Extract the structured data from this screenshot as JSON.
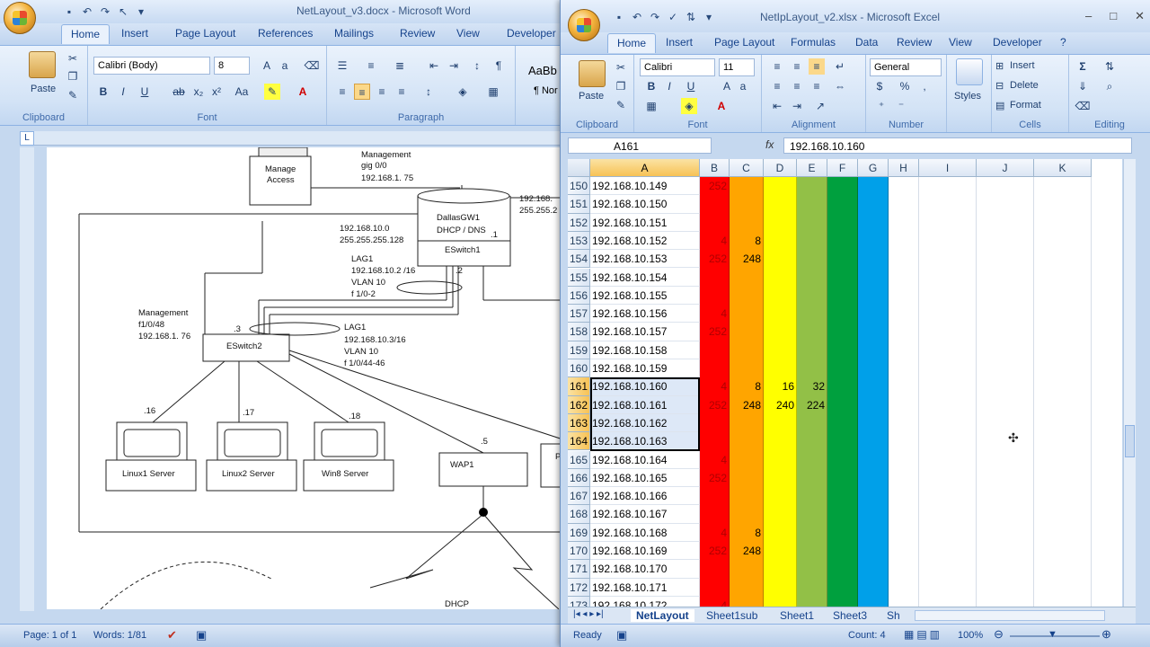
{
  "word": {
    "title": "NetLayout_v3.docx - Microsoft Word",
    "tabs": [
      "Home",
      "Insert",
      "Page Layout",
      "References",
      "Mailings",
      "Review",
      "View",
      "Developer"
    ],
    "font_name": "Calibri (Body)",
    "font_size": "8",
    "styles_preview": "AaBb",
    "styles_sub": "¶ Nor",
    "groups": {
      "clipboard": "Clipboard",
      "font": "Font",
      "paragraph": "Paragraph"
    },
    "paste_label": "Paste",
    "status": {
      "page": "Page: 1 of 1",
      "words": "Words: 1/81"
    },
    "diagram": {
      "manage_access": [
        "Manage",
        "Access"
      ],
      "mgmt_top": [
        "Management",
        "gig 0/0",
        "192.168.1. 75"
      ],
      "gw": [
        "DallasGW1",
        "DHCP / DNS"
      ],
      "eswitch1": "ESwitch1",
      "right_ip": [
        "192.168.",
        "255.255.2"
      ],
      "net": [
        "192.168.10.0",
        "255.255.255.128"
      ],
      "lag1_top": [
        "LAG1",
        "192.168.10.2 /16",
        "VLAN 10",
        "f 1/0-2"
      ],
      "dot1": ".1",
      "dot2": ".2",
      "dot3": ".3",
      "dot5": ".5",
      "mgmt_left": [
        "Management",
        "f1/0/48",
        "192.168.1. 76"
      ],
      "eswitch2": "ESwitch2",
      "lag1_bot": [
        "LAG1",
        "192.168.10.3/16",
        "VLAN 10",
        "f 1/0/44-46"
      ],
      "dot16": ".16",
      "dot17": ".17",
      "dot18": ".18",
      "linux1": "Linux1 Server",
      "linux2": "Linux2 Server",
      "win8": "Win8 Server",
      "wap1": "WAP1",
      "p": "P",
      "dhcp": "DHCP"
    }
  },
  "excel": {
    "title": "NetIpLayout_v2.xlsx - Microsoft Excel",
    "tabs": [
      "Home",
      "Insert",
      "Page Layout",
      "Formulas",
      "Data",
      "Review",
      "View",
      "Developer"
    ],
    "font_name": "Calibri",
    "font_size": "11",
    "number_format": "General",
    "paste_label": "Paste",
    "styles_label": "Styles",
    "cells_items": [
      "Insert",
      "Delete",
      "Format"
    ],
    "groups": {
      "clipboard": "Clipboard",
      "font": "Font",
      "alignment": "Alignment",
      "number": "Number",
      "cells": "Cells",
      "editing": "Editing"
    },
    "name_box": "A161",
    "formula": "192.168.10.160",
    "fx": "fx",
    "columns": [
      "A",
      "B",
      "C",
      "D",
      "E",
      "F",
      "G",
      "H",
      "I",
      "J",
      "K"
    ],
    "column_colors": {
      "B": "#ff0000",
      "C": "#ffa500",
      "D": "#ffff00",
      "E": "#92c047",
      "F": "#00a03e",
      "G": "#00a0e9"
    },
    "rows": [
      {
        "n": "150",
        "a": "192.168.10.149",
        "b": "252"
      },
      {
        "n": "151",
        "a": "192.168.10.150"
      },
      {
        "n": "152",
        "a": "192.168.10.151"
      },
      {
        "n": "153",
        "a": "192.168.10.152",
        "b": "4",
        "c": "8"
      },
      {
        "n": "154",
        "a": "192.168.10.153",
        "b": "252",
        "c": "248"
      },
      {
        "n": "155",
        "a": "192.168.10.154"
      },
      {
        "n": "156",
        "a": "192.168.10.155"
      },
      {
        "n": "157",
        "a": "192.168.10.156",
        "b": "4"
      },
      {
        "n": "158",
        "a": "192.168.10.157",
        "b": "252"
      },
      {
        "n": "159",
        "a": "192.168.10.158"
      },
      {
        "n": "160",
        "a": "192.168.10.159"
      },
      {
        "n": "161",
        "a": "192.168.10.160",
        "b": "4",
        "c": "8",
        "d": "16",
        "e": "32"
      },
      {
        "n": "162",
        "a": "192.168.10.161",
        "b": "252",
        "c": "248",
        "d": "240",
        "e": "224"
      },
      {
        "n": "163",
        "a": "192.168.10.162"
      },
      {
        "n": "164",
        "a": "192.168.10.163"
      },
      {
        "n": "165",
        "a": "192.168.10.164",
        "b": "4"
      },
      {
        "n": "166",
        "a": "192.168.10.165",
        "b": "252"
      },
      {
        "n": "167",
        "a": "192.168.10.166"
      },
      {
        "n": "168",
        "a": "192.168.10.167"
      },
      {
        "n": "169",
        "a": "192.168.10.168",
        "b": "4",
        "c": "8"
      },
      {
        "n": "170",
        "a": "192.168.10.169",
        "b": "252",
        "c": "248"
      },
      {
        "n": "171",
        "a": "192.168.10.170"
      },
      {
        "n": "172",
        "a": "192.168.10.171"
      },
      {
        "n": "173",
        "a": "192.168.10.172",
        "b": "4"
      }
    ],
    "sheet_tabs": [
      "NetLayout",
      "Sheet1sub",
      "Sheet1",
      "Sheet3",
      "Sh"
    ],
    "status": {
      "ready": "Ready",
      "count": "Count: 4",
      "zoom": "100%"
    }
  }
}
